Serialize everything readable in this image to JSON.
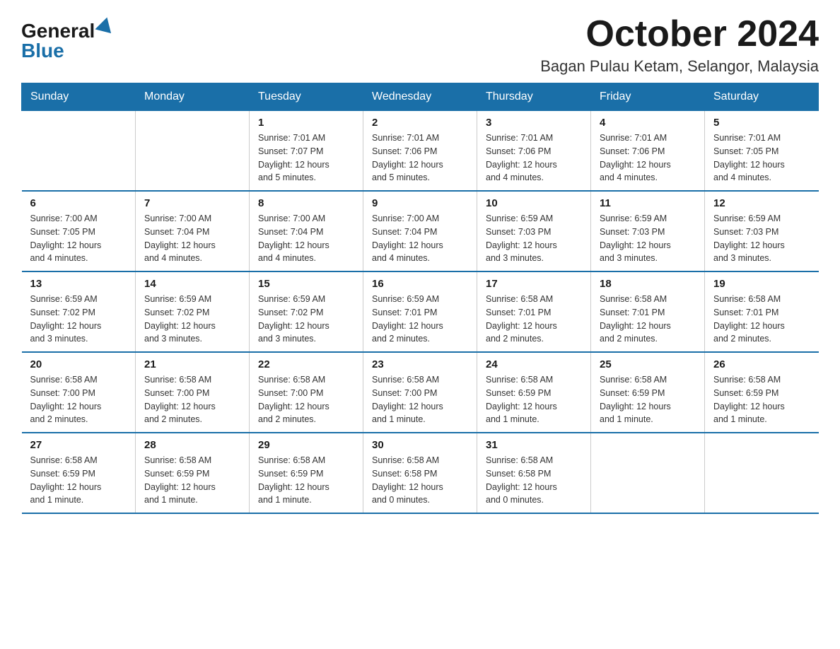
{
  "logo": {
    "general": "General",
    "blue": "Blue"
  },
  "title": {
    "month": "October 2024",
    "location": "Bagan Pulau Ketam, Selangor, Malaysia"
  },
  "header_days": [
    "Sunday",
    "Monday",
    "Tuesday",
    "Wednesday",
    "Thursday",
    "Friday",
    "Saturday"
  ],
  "weeks": [
    [
      {
        "day": "",
        "info": ""
      },
      {
        "day": "",
        "info": ""
      },
      {
        "day": "1",
        "info": "Sunrise: 7:01 AM\nSunset: 7:07 PM\nDaylight: 12 hours\nand 5 minutes."
      },
      {
        "day": "2",
        "info": "Sunrise: 7:01 AM\nSunset: 7:06 PM\nDaylight: 12 hours\nand 5 minutes."
      },
      {
        "day": "3",
        "info": "Sunrise: 7:01 AM\nSunset: 7:06 PM\nDaylight: 12 hours\nand 4 minutes."
      },
      {
        "day": "4",
        "info": "Sunrise: 7:01 AM\nSunset: 7:06 PM\nDaylight: 12 hours\nand 4 minutes."
      },
      {
        "day": "5",
        "info": "Sunrise: 7:01 AM\nSunset: 7:05 PM\nDaylight: 12 hours\nand 4 minutes."
      }
    ],
    [
      {
        "day": "6",
        "info": "Sunrise: 7:00 AM\nSunset: 7:05 PM\nDaylight: 12 hours\nand 4 minutes."
      },
      {
        "day": "7",
        "info": "Sunrise: 7:00 AM\nSunset: 7:04 PM\nDaylight: 12 hours\nand 4 minutes."
      },
      {
        "day": "8",
        "info": "Sunrise: 7:00 AM\nSunset: 7:04 PM\nDaylight: 12 hours\nand 4 minutes."
      },
      {
        "day": "9",
        "info": "Sunrise: 7:00 AM\nSunset: 7:04 PM\nDaylight: 12 hours\nand 4 minutes."
      },
      {
        "day": "10",
        "info": "Sunrise: 6:59 AM\nSunset: 7:03 PM\nDaylight: 12 hours\nand 3 minutes."
      },
      {
        "day": "11",
        "info": "Sunrise: 6:59 AM\nSunset: 7:03 PM\nDaylight: 12 hours\nand 3 minutes."
      },
      {
        "day": "12",
        "info": "Sunrise: 6:59 AM\nSunset: 7:03 PM\nDaylight: 12 hours\nand 3 minutes."
      }
    ],
    [
      {
        "day": "13",
        "info": "Sunrise: 6:59 AM\nSunset: 7:02 PM\nDaylight: 12 hours\nand 3 minutes."
      },
      {
        "day": "14",
        "info": "Sunrise: 6:59 AM\nSunset: 7:02 PM\nDaylight: 12 hours\nand 3 minutes."
      },
      {
        "day": "15",
        "info": "Sunrise: 6:59 AM\nSunset: 7:02 PM\nDaylight: 12 hours\nand 3 minutes."
      },
      {
        "day": "16",
        "info": "Sunrise: 6:59 AM\nSunset: 7:01 PM\nDaylight: 12 hours\nand 2 minutes."
      },
      {
        "day": "17",
        "info": "Sunrise: 6:58 AM\nSunset: 7:01 PM\nDaylight: 12 hours\nand 2 minutes."
      },
      {
        "day": "18",
        "info": "Sunrise: 6:58 AM\nSunset: 7:01 PM\nDaylight: 12 hours\nand 2 minutes."
      },
      {
        "day": "19",
        "info": "Sunrise: 6:58 AM\nSunset: 7:01 PM\nDaylight: 12 hours\nand 2 minutes."
      }
    ],
    [
      {
        "day": "20",
        "info": "Sunrise: 6:58 AM\nSunset: 7:00 PM\nDaylight: 12 hours\nand 2 minutes."
      },
      {
        "day": "21",
        "info": "Sunrise: 6:58 AM\nSunset: 7:00 PM\nDaylight: 12 hours\nand 2 minutes."
      },
      {
        "day": "22",
        "info": "Sunrise: 6:58 AM\nSunset: 7:00 PM\nDaylight: 12 hours\nand 2 minutes."
      },
      {
        "day": "23",
        "info": "Sunrise: 6:58 AM\nSunset: 7:00 PM\nDaylight: 12 hours\nand 1 minute."
      },
      {
        "day": "24",
        "info": "Sunrise: 6:58 AM\nSunset: 6:59 PM\nDaylight: 12 hours\nand 1 minute."
      },
      {
        "day": "25",
        "info": "Sunrise: 6:58 AM\nSunset: 6:59 PM\nDaylight: 12 hours\nand 1 minute."
      },
      {
        "day": "26",
        "info": "Sunrise: 6:58 AM\nSunset: 6:59 PM\nDaylight: 12 hours\nand 1 minute."
      }
    ],
    [
      {
        "day": "27",
        "info": "Sunrise: 6:58 AM\nSunset: 6:59 PM\nDaylight: 12 hours\nand 1 minute."
      },
      {
        "day": "28",
        "info": "Sunrise: 6:58 AM\nSunset: 6:59 PM\nDaylight: 12 hours\nand 1 minute."
      },
      {
        "day": "29",
        "info": "Sunrise: 6:58 AM\nSunset: 6:59 PM\nDaylight: 12 hours\nand 1 minute."
      },
      {
        "day": "30",
        "info": "Sunrise: 6:58 AM\nSunset: 6:58 PM\nDaylight: 12 hours\nand 0 minutes."
      },
      {
        "day": "31",
        "info": "Sunrise: 6:58 AM\nSunset: 6:58 PM\nDaylight: 12 hours\nand 0 minutes."
      },
      {
        "day": "",
        "info": ""
      },
      {
        "day": "",
        "info": ""
      }
    ]
  ]
}
